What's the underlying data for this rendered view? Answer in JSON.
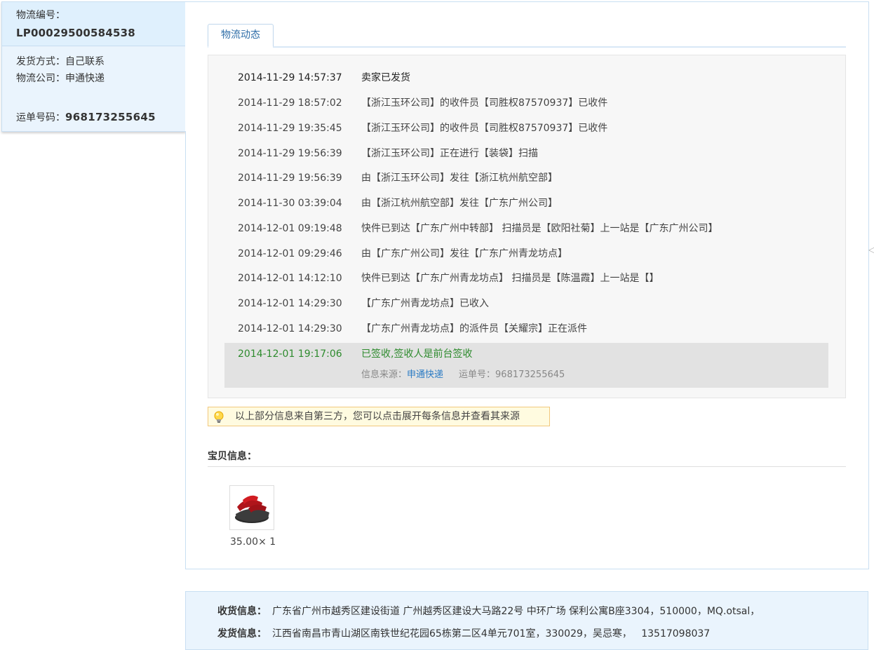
{
  "logistics_info": {
    "number_label": "物流编号：",
    "number_value": "LP00029500584538",
    "shipping_method": "发货方式：自己联系",
    "company": "物流公司：申通快递",
    "waybill_label": "运单号码：",
    "waybill_value": "968173255645"
  },
  "tabs": [
    {
      "label": "物流动态"
    }
  ],
  "tracking": [
    {
      "time": "2014-11-29 14:57:37",
      "desc": "卖家已发货"
    },
    {
      "time": "2014-11-29 18:57:02",
      "desc": "【浙江玉环公司】的收件员【司胜权87570937】已收件"
    },
    {
      "time": "2014-11-29 19:35:45",
      "desc": "【浙江玉环公司】的收件员【司胜权87570937】已收件"
    },
    {
      "time": "2014-11-29 19:56:39",
      "desc": "【浙江玉环公司】正在进行【装袋】扫描"
    },
    {
      "time": "2014-11-29 19:56:39",
      "desc": "由【浙江玉环公司】发往【浙江杭州航空部】"
    },
    {
      "time": "2014-11-30 03:39:04",
      "desc": "由【浙江杭州航空部】发往【广东广州公司】"
    },
    {
      "time": "2014-12-01 09:19:48",
      "desc": "快件已到达【广东广州中转部】 扫描员是【欧阳社菊】上一站是【广东广州公司】"
    },
    {
      "time": "2014-12-01 09:29:46",
      "desc": "由【广东广州公司】发往【广东广州青龙坊点】"
    },
    {
      "time": "2014-12-01 14:12:10",
      "desc": "快件已到达【广东广州青龙坊点】 扫描员是【陈温霞】上一站是【】"
    },
    {
      "time": "2014-12-01 14:29:30",
      "desc": "【广东广州青龙坊点】已收入"
    },
    {
      "time": "2014-12-01 14:29:30",
      "desc": "【广东广州青龙坊点】的派件员【关耀宗】正在派件"
    },
    {
      "time": "2014-12-01 19:17:06",
      "desc": "已签收,签收人是前台签收"
    }
  ],
  "source": {
    "label": "信息来源：",
    "link": "申通快递",
    "waybill": "运单号：968173255645"
  },
  "tip": "以上部分信息来自第三方，您可以点击展开每条信息并查看其来源",
  "goods": {
    "title": "宝贝信息：",
    "price": "35.00× 1"
  },
  "address": {
    "receive_label": "收货信息：",
    "receive_value": "广东省广州市越秀区建设街道 广州越秀区建设大马路22号 中环广场 保利公寓B座3304，510000，MQ.otsal，",
    "send_label": "发货信息：",
    "send_value": "江西省南昌市青山湖区南铁世纪花园65栋第二区4单元701室，330029，吴忌寒，   13517098037"
  },
  "colors": {
    "accent_blue": "#2a7bc4",
    "signed_green": "#2e8b2e",
    "panel_blue": "#eaf4fd"
  }
}
